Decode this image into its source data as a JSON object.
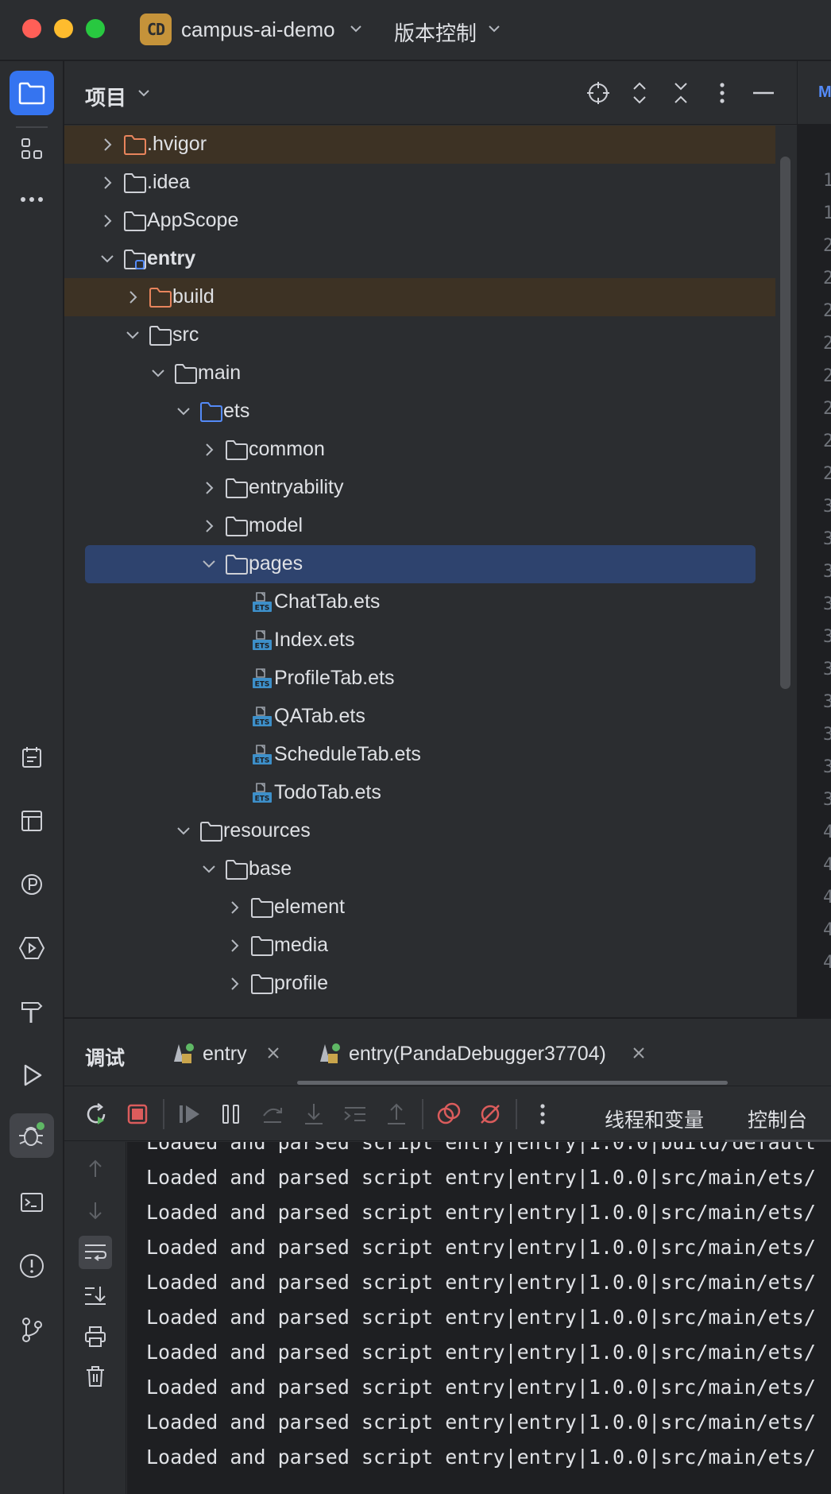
{
  "window": {
    "project_badge": "CD",
    "project_name": "campus-ai-demo",
    "vcs_label": "版本控制"
  },
  "project_panel": {
    "title": "项目",
    "tree": [
      {
        "label": ".hvigor",
        "depth": 0,
        "expanded": false,
        "kind": "folder-excluded"
      },
      {
        "label": ".idea",
        "depth": 0,
        "expanded": false,
        "kind": "folder"
      },
      {
        "label": "AppScope",
        "depth": 0,
        "expanded": false,
        "kind": "folder"
      },
      {
        "label": "entry",
        "depth": 0,
        "expanded": true,
        "kind": "module"
      },
      {
        "label": "build",
        "depth": 1,
        "expanded": false,
        "kind": "folder-excluded"
      },
      {
        "label": "src",
        "depth": 1,
        "expanded": true,
        "kind": "folder"
      },
      {
        "label": "main",
        "depth": 2,
        "expanded": true,
        "kind": "folder"
      },
      {
        "label": "ets",
        "depth": 3,
        "expanded": true,
        "kind": "folder-source"
      },
      {
        "label": "common",
        "depth": 4,
        "expanded": false,
        "kind": "folder"
      },
      {
        "label": "entryability",
        "depth": 4,
        "expanded": false,
        "kind": "folder"
      },
      {
        "label": "model",
        "depth": 4,
        "expanded": false,
        "kind": "folder"
      },
      {
        "label": "pages",
        "depth": 4,
        "expanded": true,
        "kind": "folder",
        "selected": true
      },
      {
        "label": "ChatTab.ets",
        "depth": 5,
        "kind": "ets-file"
      },
      {
        "label": "Index.ets",
        "depth": 5,
        "kind": "ets-file"
      },
      {
        "label": "ProfileTab.ets",
        "depth": 5,
        "kind": "ets-file"
      },
      {
        "label": "QATab.ets",
        "depth": 5,
        "kind": "ets-file"
      },
      {
        "label": "ScheduleTab.ets",
        "depth": 5,
        "kind": "ets-file"
      },
      {
        "label": "TodoTab.ets",
        "depth": 5,
        "kind": "ets-file"
      },
      {
        "label": "resources",
        "depth": 3,
        "expanded": true,
        "kind": "folder"
      },
      {
        "label": "base",
        "depth": 4,
        "expanded": true,
        "kind": "folder"
      },
      {
        "label": "element",
        "depth": 5,
        "expanded": false,
        "kind": "folder"
      },
      {
        "label": "media",
        "depth": 5,
        "expanded": false,
        "kind": "folder"
      },
      {
        "label": "profile",
        "depth": 5,
        "expanded": false,
        "kind": "folder"
      }
    ]
  },
  "debug_panel": {
    "title": "调试",
    "tabs": [
      {
        "label": "entry"
      },
      {
        "label": "entry(PandaDebugger37704)"
      }
    ],
    "toolbar_tabs": [
      "线程和变量",
      "控制台"
    ],
    "console_lines": [
      "Loaded and parsed script entry|entry|1.0.0|build/default",
      "Loaded and parsed script entry|entry|1.0.0|src/main/ets/",
      "Loaded and parsed script entry|entry|1.0.0|src/main/ets/",
      "Loaded and parsed script entry|entry|1.0.0|src/main/ets/",
      "Loaded and parsed script entry|entry|1.0.0|src/main/ets/",
      "Loaded and parsed script entry|entry|1.0.0|src/main/ets/",
      "Loaded and parsed script entry|entry|1.0.0|src/main/ets/",
      "Loaded and parsed script entry|entry|1.0.0|src/main/ets/",
      "Loaded and parsed script entry|entry|1.0.0|src/main/ets/",
      "Loaded and parsed script entry|entry|1.0.0|src/main/ets/"
    ]
  },
  "editor_peek": {
    "tab_letter": "M",
    "gutter": [
      "1",
      "1",
      "2",
      "2",
      "2",
      "2",
      "2",
      "2",
      "2",
      "2",
      "3",
      "3",
      "3",
      "3",
      "3",
      "3",
      "3",
      "3",
      "3",
      "3",
      "4",
      "4",
      "4",
      "4",
      "4"
    ]
  },
  "colors": {
    "accent": "#3574f0",
    "excluded_row": "#3d3224",
    "selected_row": "#2e436e",
    "excluded_folder": "#e8845c",
    "source_folder": "#548af7",
    "stop_red": "#db5c5c",
    "run_green": "#5fb865"
  }
}
